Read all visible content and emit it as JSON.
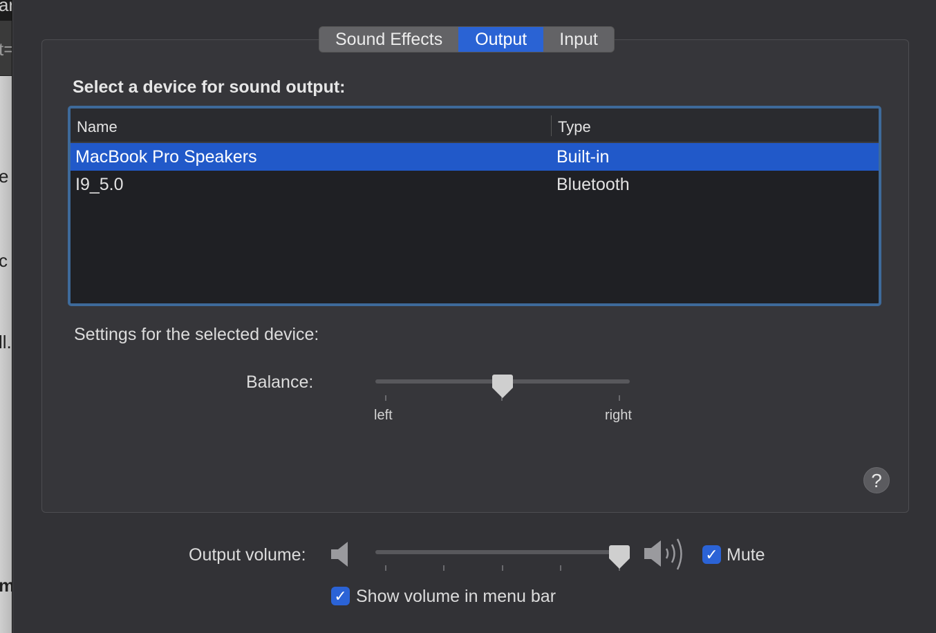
{
  "background_app": {
    "fragments": [
      "ar",
      "t=",
      "e",
      "c",
      "ll.",
      "m"
    ]
  },
  "tabs": [
    {
      "label": "Sound Effects",
      "active": false
    },
    {
      "label": "Output",
      "active": true
    },
    {
      "label": "Input",
      "active": false
    }
  ],
  "output": {
    "heading": "Select a device for sound output:",
    "columns": [
      "Name",
      "Type"
    ],
    "devices": [
      {
        "name": "MacBook Pro Speakers",
        "type": "Built-in",
        "selected": true
      },
      {
        "name": "I9_5.0",
        "type": "Bluetooth",
        "selected": false
      }
    ],
    "settings_heading": "Settings for the selected device:",
    "balance": {
      "label": "Balance:",
      "left": "left",
      "right": "right",
      "value": 0.5
    }
  },
  "help": "?",
  "volume": {
    "label": "Output volume:",
    "value": 1.0,
    "mute_label": "Mute",
    "mute_checked": true,
    "show_in_menu_bar_label": "Show volume in menu bar",
    "show_in_menu_bar_checked": true
  },
  "colors": {
    "accent": "#2a63d4",
    "selection": "#2159c9"
  }
}
